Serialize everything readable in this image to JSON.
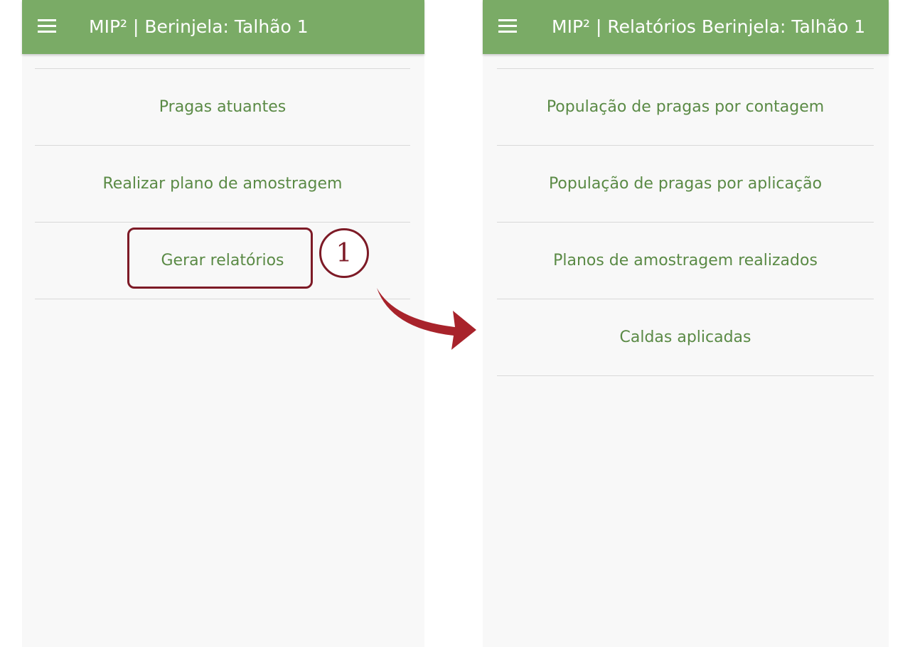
{
  "left_screen": {
    "title": "MIP² | Berinjela: Talhão 1",
    "items": [
      {
        "label": "Pragas atuantes"
      },
      {
        "label": "Realizar plano de amostragem"
      },
      {
        "label": "Gerar relatórios"
      }
    ]
  },
  "right_screen": {
    "title": "MIP² | Relatórios Berinjela: Talhão 1",
    "items": [
      {
        "label": "População de pragas por contagem"
      },
      {
        "label": "População de pragas por aplicação"
      },
      {
        "label": "Planos de amostragem realizados"
      },
      {
        "label": "Caldas aplicadas"
      }
    ]
  },
  "annotation": {
    "step_number": "1",
    "accent_color": "#7d1a26",
    "arrow_color": "#a8232b"
  },
  "theme": {
    "appbar_color": "#7aab66",
    "item_text_color": "#5a8a45",
    "background_color": "#f8f8f8"
  }
}
